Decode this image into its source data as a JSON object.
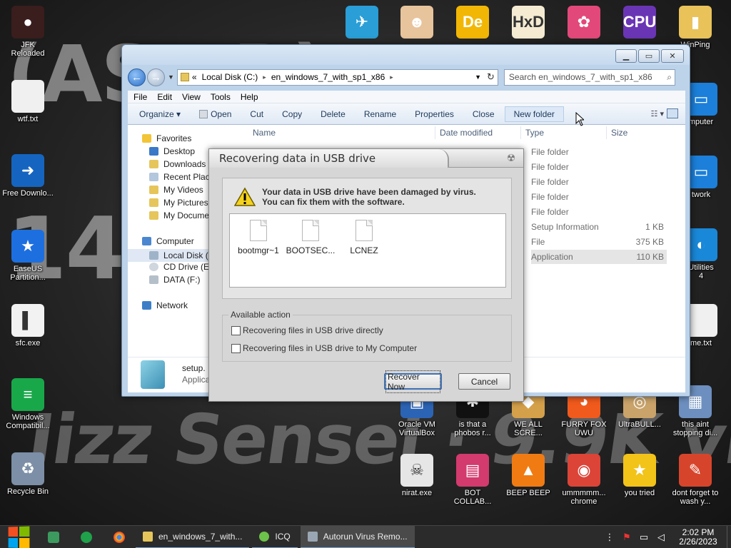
{
  "wallpaper": {
    "line1": "(ASMR)",
    "line2": "14 Year",
    "line3": "Jizz Sensei · 9.9K views · 1 day ago"
  },
  "desktop_icons": [
    {
      "name": "jfk-reloaded-icon",
      "label": "JFK\nReloaded",
      "color": "#3a1d1d",
      "glyph": "●"
    },
    {
      "name": "wtf-txt-icon",
      "label": "wtf.txt",
      "color": "#f0f0f0",
      "glyph": ""
    },
    {
      "name": "free-download-icon",
      "label": "Free Downlo...",
      "color": "#1565c0",
      "glyph": "➜"
    },
    {
      "name": "easeus-icon",
      "label": "EaseUS Partition...",
      "color": "#1d6fe0",
      "glyph": "★"
    },
    {
      "name": "sfc-exe-icon",
      "label": "sfc.exe",
      "color": "#f2f2f2",
      "glyph": "▌"
    },
    {
      "name": "windows-compat-icon",
      "label": "Windows Compatibil...",
      "color": "#18a84a",
      "glyph": "≡"
    },
    {
      "name": "recycle-bin-icon",
      "label": "Recycle Bin",
      "color": "#7c8fa6",
      "glyph": "♻"
    },
    {
      "name": "flight-sim-icon",
      "label": "",
      "color": "#2a9ed6",
      "glyph": "✈"
    },
    {
      "name": "doctor-icon",
      "label": "",
      "color": "#e8c49c",
      "glyph": "☻"
    },
    {
      "name": "de-icon",
      "label": "",
      "color": "#f2b705",
      "glyph": "De"
    },
    {
      "name": "hxd-icon",
      "label": "",
      "color": "#f4ebd2",
      "glyph": "HxD"
    },
    {
      "name": "pinwheel-icon",
      "label": "",
      "color": "#e2497a",
      "glyph": "✿"
    },
    {
      "name": "cpuz-icon",
      "label": "",
      "color": "#6a35b5",
      "glyph": "CPU"
    },
    {
      "name": "winping-icon",
      "label": "WinPing",
      "color": "#e9c25a",
      "glyph": "▮"
    },
    {
      "name": "computer-icon",
      "label": "mputer",
      "color": "#1c7fd9",
      "glyph": "▭"
    },
    {
      "name": "network-icon",
      "label": "twork",
      "color": "#1c7fd9",
      "glyph": "▭"
    },
    {
      "name": "utilities-icon",
      "label": "Utilities\n4",
      "color": "#1a88d8",
      "glyph": "◐"
    },
    {
      "name": "me-txt-icon",
      "label": "me.txt",
      "color": "#f0f0f0",
      "glyph": ""
    },
    {
      "name": "oracle-vm-icon",
      "label": "Oracle VM VirtualBox",
      "color": "#2c64b5",
      "glyph": "▣"
    },
    {
      "name": "phobos-icon",
      "label": "is that a phobos r...",
      "color": "#111111",
      "glyph": "✱"
    },
    {
      "name": "we-all-scream-icon",
      "label": "WE ALL SCRE...",
      "color": "#d4a04a",
      "glyph": "◆"
    },
    {
      "name": "furry-fox-icon",
      "label": "FURRY FOX UWU",
      "color": "#f05a1c",
      "glyph": "◕"
    },
    {
      "name": "ultrabull-icon",
      "label": "UltraBULL...",
      "color": "#c9a36a",
      "glyph": "◎"
    },
    {
      "name": "this-aint-icon",
      "label": "this aint stopping di...",
      "color": "#6d8fbf",
      "glyph": "▦"
    },
    {
      "name": "nirat-icon",
      "label": "nirat.exe",
      "color": "#e6e6e6",
      "glyph": "☠"
    },
    {
      "name": "bot-collab-icon",
      "label": "BOT COLLAB...",
      "color": "#d33a6e",
      "glyph": "▤"
    },
    {
      "name": "beep-beep-icon",
      "label": "BEEP BEEP",
      "color": "#f07b13",
      "glyph": "▲"
    },
    {
      "name": "chrome-icon",
      "label": "ummmmm... chrome",
      "color": "#db4437",
      "glyph": "◉"
    },
    {
      "name": "you-tried-icon",
      "label": "you tried",
      "color": "#f2c318",
      "glyph": "★"
    },
    {
      "name": "dont-forget-icon",
      "label": "dont forget to wash y...",
      "color": "#d6452b",
      "glyph": "✎"
    }
  ],
  "explorer": {
    "address": {
      "prefix": "«",
      "crumb1": "Local Disk (C:)",
      "crumb2": "en_windows_7_with_sp1_x86"
    },
    "search_placeholder": "Search en_windows_7_with_sp1_x86",
    "menu": [
      "File",
      "Edit",
      "View",
      "Tools",
      "Help"
    ],
    "toolbar": {
      "organize": "Organize ▾",
      "open": "Open",
      "cut": "Cut",
      "copy": "Copy",
      "delete": "Delete",
      "rename": "Rename",
      "properties": "Properties",
      "close": "Close",
      "new_folder": "New folder"
    },
    "nav": {
      "favorites": "Favorites",
      "desktop": "Desktop",
      "downloads": "Downloads",
      "recent": "Recent Plac",
      "videos": "My Videos",
      "pictures": "My Pictures",
      "documents": "My Docume",
      "computer": "Computer",
      "local_disk": "Local Disk (",
      "cd_drive": "CD Drive (E",
      "data_drive": "DATA (F:)",
      "network": "Network"
    },
    "columns": {
      "name": "Name",
      "date": "Date modified",
      "type": "Type",
      "size": "Size"
    },
    "rows": [
      {
        "type": "File folder",
        "size": ""
      },
      {
        "type": "File folder",
        "size": ""
      },
      {
        "type": "File folder",
        "size": ""
      },
      {
        "type": "File folder",
        "size": ""
      },
      {
        "type": "File folder",
        "size": ""
      },
      {
        "type": "Setup Information",
        "size": "1 KB"
      },
      {
        "type": "File",
        "size": "375 KB"
      },
      {
        "type": "Application",
        "size": "110 KB"
      }
    ],
    "details": {
      "name": "setup.",
      "type": "Applica"
    }
  },
  "dialog": {
    "title": "Recovering data in USB drive",
    "warning_line1": "Your data in USB drive have been damaged by virus.",
    "warning_line2": "You can fix them with the software.",
    "files": [
      "bootmgr~1",
      "BOOTSEC...",
      "LCNEZ"
    ],
    "actions_legend": "Available action",
    "option1": "Recovering files in USB drive directly",
    "option2": "Recovering files in USB drive to My Computer",
    "recover_button": "Recover Now",
    "cancel_button": "Cancel"
  },
  "taskbar": {
    "tasks": [
      {
        "label": "en_windows_7_with...",
        "active": false
      },
      {
        "label": "ICQ",
        "active": false
      },
      {
        "label": "Autorun Virus Remo...",
        "active": true
      }
    ],
    "time": "2:02 PM",
    "date": "2/26/2023"
  }
}
